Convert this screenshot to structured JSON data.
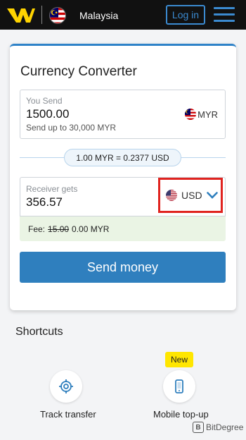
{
  "header": {
    "country": "Malaysia",
    "login_label": "Log in",
    "brand_color": "#ffd400",
    "accent_color": "#3b8ad0"
  },
  "converter": {
    "title": "Currency Converter",
    "send": {
      "label": "You Send",
      "amount": "1500.00",
      "hint": "Send up to 30,000  MYR",
      "currency": "MYR"
    },
    "rate": "1.00 MYR = 0.2377 USD",
    "receive": {
      "label": "Receiver gets",
      "amount": "356.57",
      "currency": "USD",
      "currency_icon": "chevron-down-icon"
    },
    "fee": {
      "label": "Fee:",
      "original": "15.00",
      "current": "0.00 MYR"
    },
    "send_button": "Send money"
  },
  "shortcuts": {
    "title": "Shortcuts",
    "items": [
      {
        "label": "Track transfer",
        "icon": "target-icon"
      },
      {
        "label": "Mobile top-up",
        "icon": "mobile-phone-icon",
        "badge": "New"
      }
    ]
  },
  "watermark": {
    "text": "BitDegree"
  }
}
